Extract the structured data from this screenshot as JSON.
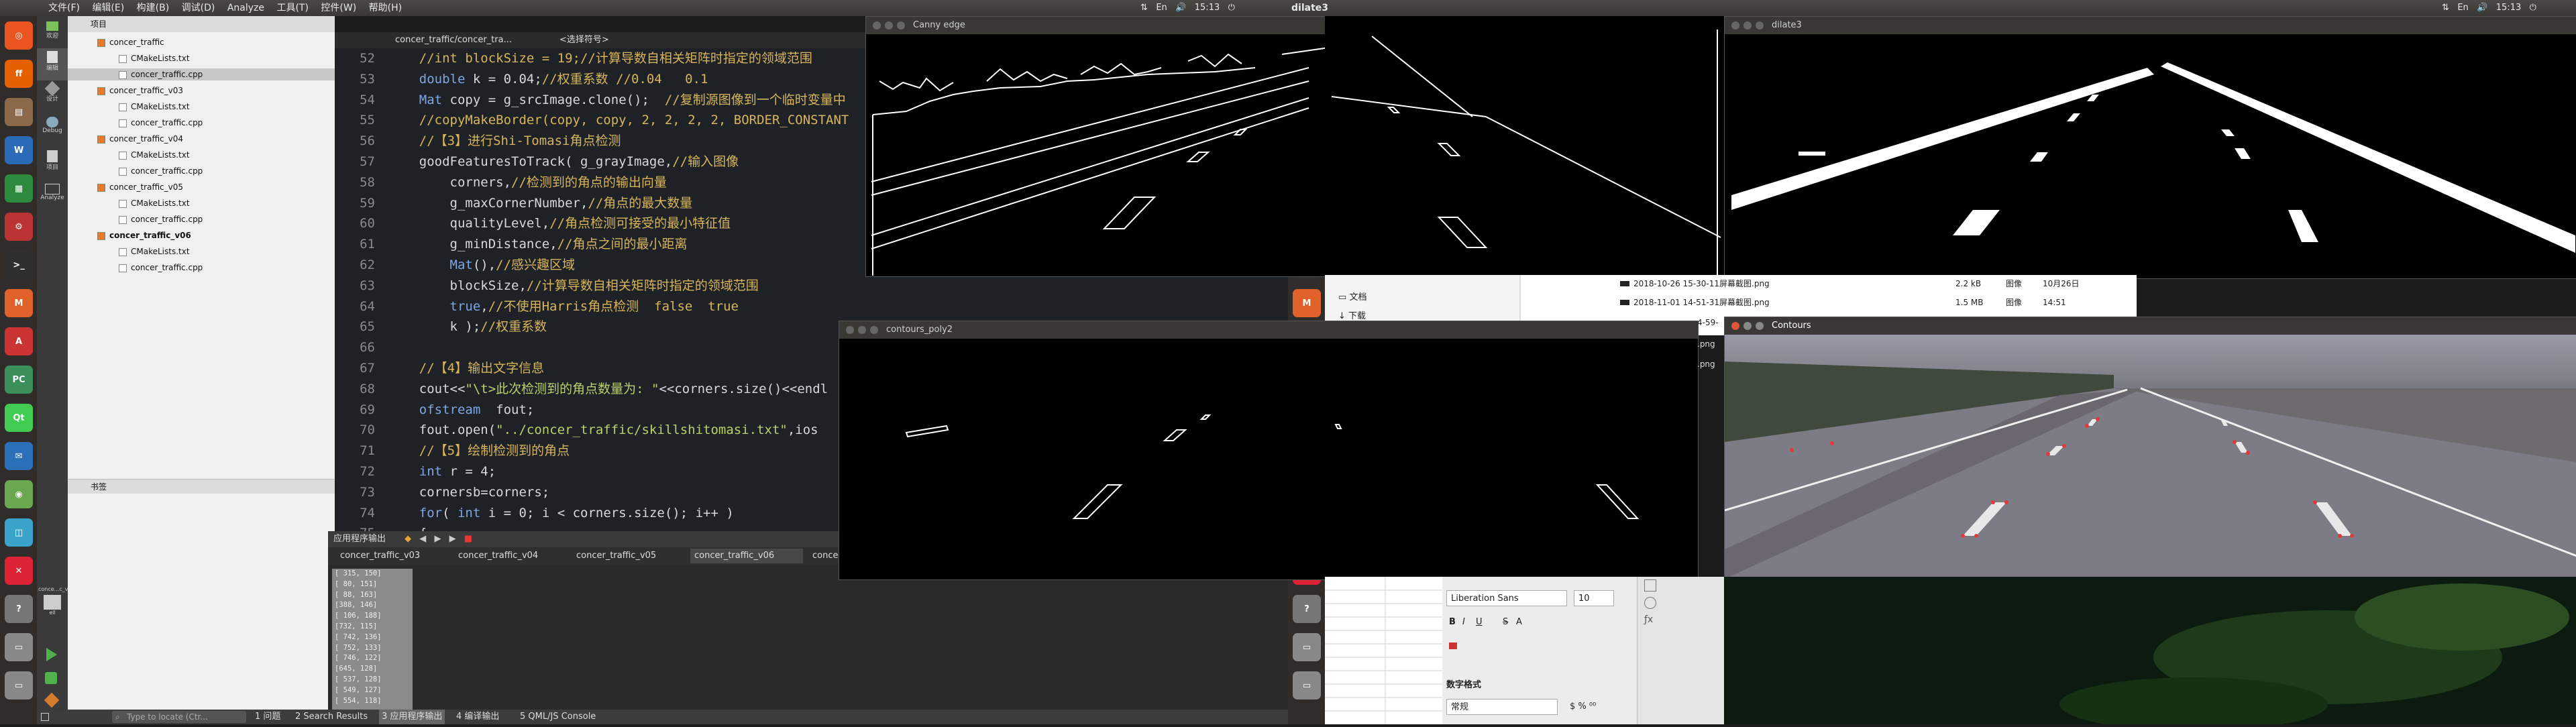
{
  "left_panel": {
    "menu": [
      "文件(F)",
      "编辑(E)",
      "构建(B)",
      "调试(D)",
      "Analyze",
      "工具(T)",
      "控件(W)",
      "帮助(H)"
    ],
    "time": "15:13",
    "window_title": "dilate3"
  },
  "right_panel": {
    "time": "15:13"
  },
  "launcher_icons": [
    "dash-icon",
    "firefox-icon",
    "files-icon",
    "writer-icon",
    "calc-icon",
    "settings-icon",
    "terminal-icon",
    "matlab-icon",
    "software-icon",
    "pycharm-icon",
    "qt-icon",
    "thunderbird-icon",
    "screenshot-icon",
    "store-icon",
    "xmind-icon",
    "help-icon",
    "drive-icon",
    "drive2-icon"
  ],
  "qt_modes": [
    "欢迎",
    "编辑",
    "设计",
    "Debug",
    "项目",
    "Analyze"
  ],
  "project_label": "项目",
  "project_tree": [
    {
      "name": "concer_traffic",
      "level": 0,
      "bold": false
    },
    {
      "name": "CMakeLists.txt",
      "level": 1,
      "bold": false
    },
    {
      "name": "concer_traffic.cpp",
      "level": 1,
      "bold": false,
      "selected": true
    },
    {
      "name": "concer_traffic_v03",
      "level": 0,
      "bold": false
    },
    {
      "name": "CMakeLists.txt",
      "level": 1,
      "bold": false
    },
    {
      "name": "concer_traffic.cpp",
      "level": 1,
      "bold": false
    },
    {
      "name": "concer_traffic_v04",
      "level": 0,
      "bold": false
    },
    {
      "name": "CMakeLists.txt",
      "level": 1,
      "bold": false
    },
    {
      "name": "concer_traffic.cpp",
      "level": 1,
      "bold": false
    },
    {
      "name": "concer_traffic_v05",
      "level": 0,
      "bold": false
    },
    {
      "name": "CMakeLists.txt",
      "level": 1,
      "bold": false
    },
    {
      "name": "concer_traffic.cpp",
      "level": 1,
      "bold": false
    },
    {
      "name": "concer_traffic_v06",
      "level": 0,
      "bold": true
    },
    {
      "name": "CMakeLists.txt",
      "level": 1,
      "bold": false
    },
    {
      "name": "concer_traffic.cpp",
      "level": 1,
      "bold": false
    }
  ],
  "bookmarks_label": "书签",
  "editor_tab": "concer_traffic/concer_tra...",
  "editor_symbol": "<选择符号>",
  "code": [
    {
      "n": "52",
      "t": "    //int blockSize = 19;//计算导数自相关矩阵时指定的领域范围"
    },
    {
      "n": "53",
      "t": "    double k = 0.04;//权重系数 //0.04   0.1"
    },
    {
      "n": "54",
      "t": "    Mat copy = g_srcImage.clone();  //复制源图像到一个临时变量中"
    },
    {
      "n": "55",
      "t": "    //copyMakeBorder(copy, copy, 2, 2, 2, 2, BORDER_CONSTANT"
    },
    {
      "n": "56",
      "t": "    //【3】进行Shi-Tomasi角点检测"
    },
    {
      "n": "57",
      "t": "    goodFeaturesToTrack( g_grayImage,//输入图像"
    },
    {
      "n": "58",
      "t": "        corners,//检测到的角点的输出向量"
    },
    {
      "n": "59",
      "t": "        g_maxCornerNumber,//角点的最大数量"
    },
    {
      "n": "60",
      "t": "        qualityLevel,//角点检测可接受的最小特征值"
    },
    {
      "n": "61",
      "t": "        g_minDistance,//角点之间的最小距离"
    },
    {
      "n": "62",
      "t": "        Mat(),//感兴趣区域"
    },
    {
      "n": "63",
      "t": "        blockSize,//计算导数自相关矩阵时指定的领域范围"
    },
    {
      "n": "64",
      "t": "        true,//不使用Harris角点检测  false  true"
    },
    {
      "n": "65",
      "t": "        k );//权重系数"
    },
    {
      "n": "66",
      "t": ""
    },
    {
      "n": "67",
      "t": "    //【4】输出文字信息"
    },
    {
      "n": "68",
      "t": "    cout<<\"\\t>此次检测到的角点数量为: \"<<corners.size()<<endl"
    },
    {
      "n": "69",
      "t": "    ofstream  fout;"
    },
    {
      "n": "70",
      "t": "    fout.open(\"../concer_traffic/skillshitomasi.txt\",ios"
    },
    {
      "n": "71",
      "t": "    //【5】绘制检测到的角点"
    },
    {
      "n": "72",
      "t": "    int r = 4;"
    },
    {
      "n": "73",
      "t": "    cornersb=corners;"
    },
    {
      "n": "74",
      "t": "    for( int i = 0; i < corners.size(); i++ )"
    },
    {
      "n": "75",
      "t": "    {"
    }
  ],
  "output_pane_label": "应用程序输出",
  "output_tabs": [
    "concer_traffic_v03",
    "concer_traffic_v04",
    "concer_traffic_v05",
    "concer_traffic_v06",
    "concer_"
  ],
  "output_lines": [
    "[ 315, 150]",
    "[ 80, 151]",
    "[ 88, 163]",
    "[388, 146]",
    "[ 106, 188]",
    "[732, 115]",
    "[ 742, 136]",
    "[ 752, 133]",
    "[ 746, 122]",
    "[645, 128]",
    "[ 537, 128]",
    "[ 549, 127]",
    "[ 554, 118]"
  ],
  "run_target": "conce...c_v06",
  "run_target_sub": "ell",
  "status_items": [
    "1 问题",
    "2 Search Results",
    "3 应用程序输出",
    "4 编译输出",
    "5 QML/JS Console"
  ],
  "locate_placeholder": "Type to locate (Ctr...",
  "windows": {
    "canny": "Canny edge",
    "dilate": "dilate3",
    "contours_poly": "contours_poly2",
    "contours": "Contours"
  },
  "file_manager": {
    "sidebar": [
      "文档",
      "下载"
    ],
    "rows": [
      {
        "name": "2018-10-26 15-30-11屏幕截图.png",
        "size": "2.2 kB",
        "type": "图像",
        "date": "10月26日"
      },
      {
        "name": "2018-11-01 14-51-31屏幕截图.png",
        "size": "1.5 MB",
        "type": "图像",
        "date": "14:51"
      }
    ],
    "extra": [
      ".png",
      ".png"
    ],
    "partial": "4-59-"
  },
  "calc": {
    "font": "Liberation Sans",
    "size": "10",
    "section": "数字格式",
    "format": "常规",
    "buttons": [
      "B",
      "I",
      "U",
      "S",
      "A"
    ]
  }
}
